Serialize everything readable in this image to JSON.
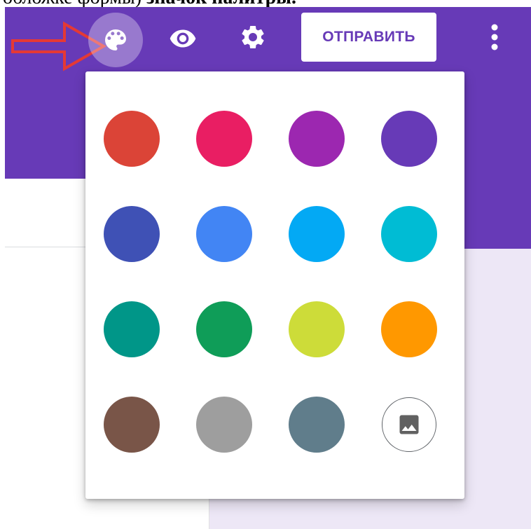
{
  "document": {
    "caption_plain": "обложке формы)",
    "caption_bold": "значок палитры."
  },
  "toolbar": {
    "palette_icon": "palette-icon",
    "preview_icon": "eye-icon",
    "settings_icon": "gear-icon",
    "send_label": "ОТПРАВИТЬ",
    "more_icon": "more-vert-icon",
    "header_color": "#673ab7"
  },
  "annotation": {
    "arrow_color": "#e53935"
  },
  "palette": {
    "swatches": [
      "#db4437",
      "#e91e63",
      "#9c27b0",
      "#673ab7",
      "#3f51b5",
      "#4285f4",
      "#03a9f4",
      "#00bcd4",
      "#009688",
      "#0f9d58",
      "#cddc39",
      "#ff9800",
      "#795548",
      "#9e9e9e",
      "#607d8b"
    ],
    "image_option_icon": "image-icon"
  }
}
